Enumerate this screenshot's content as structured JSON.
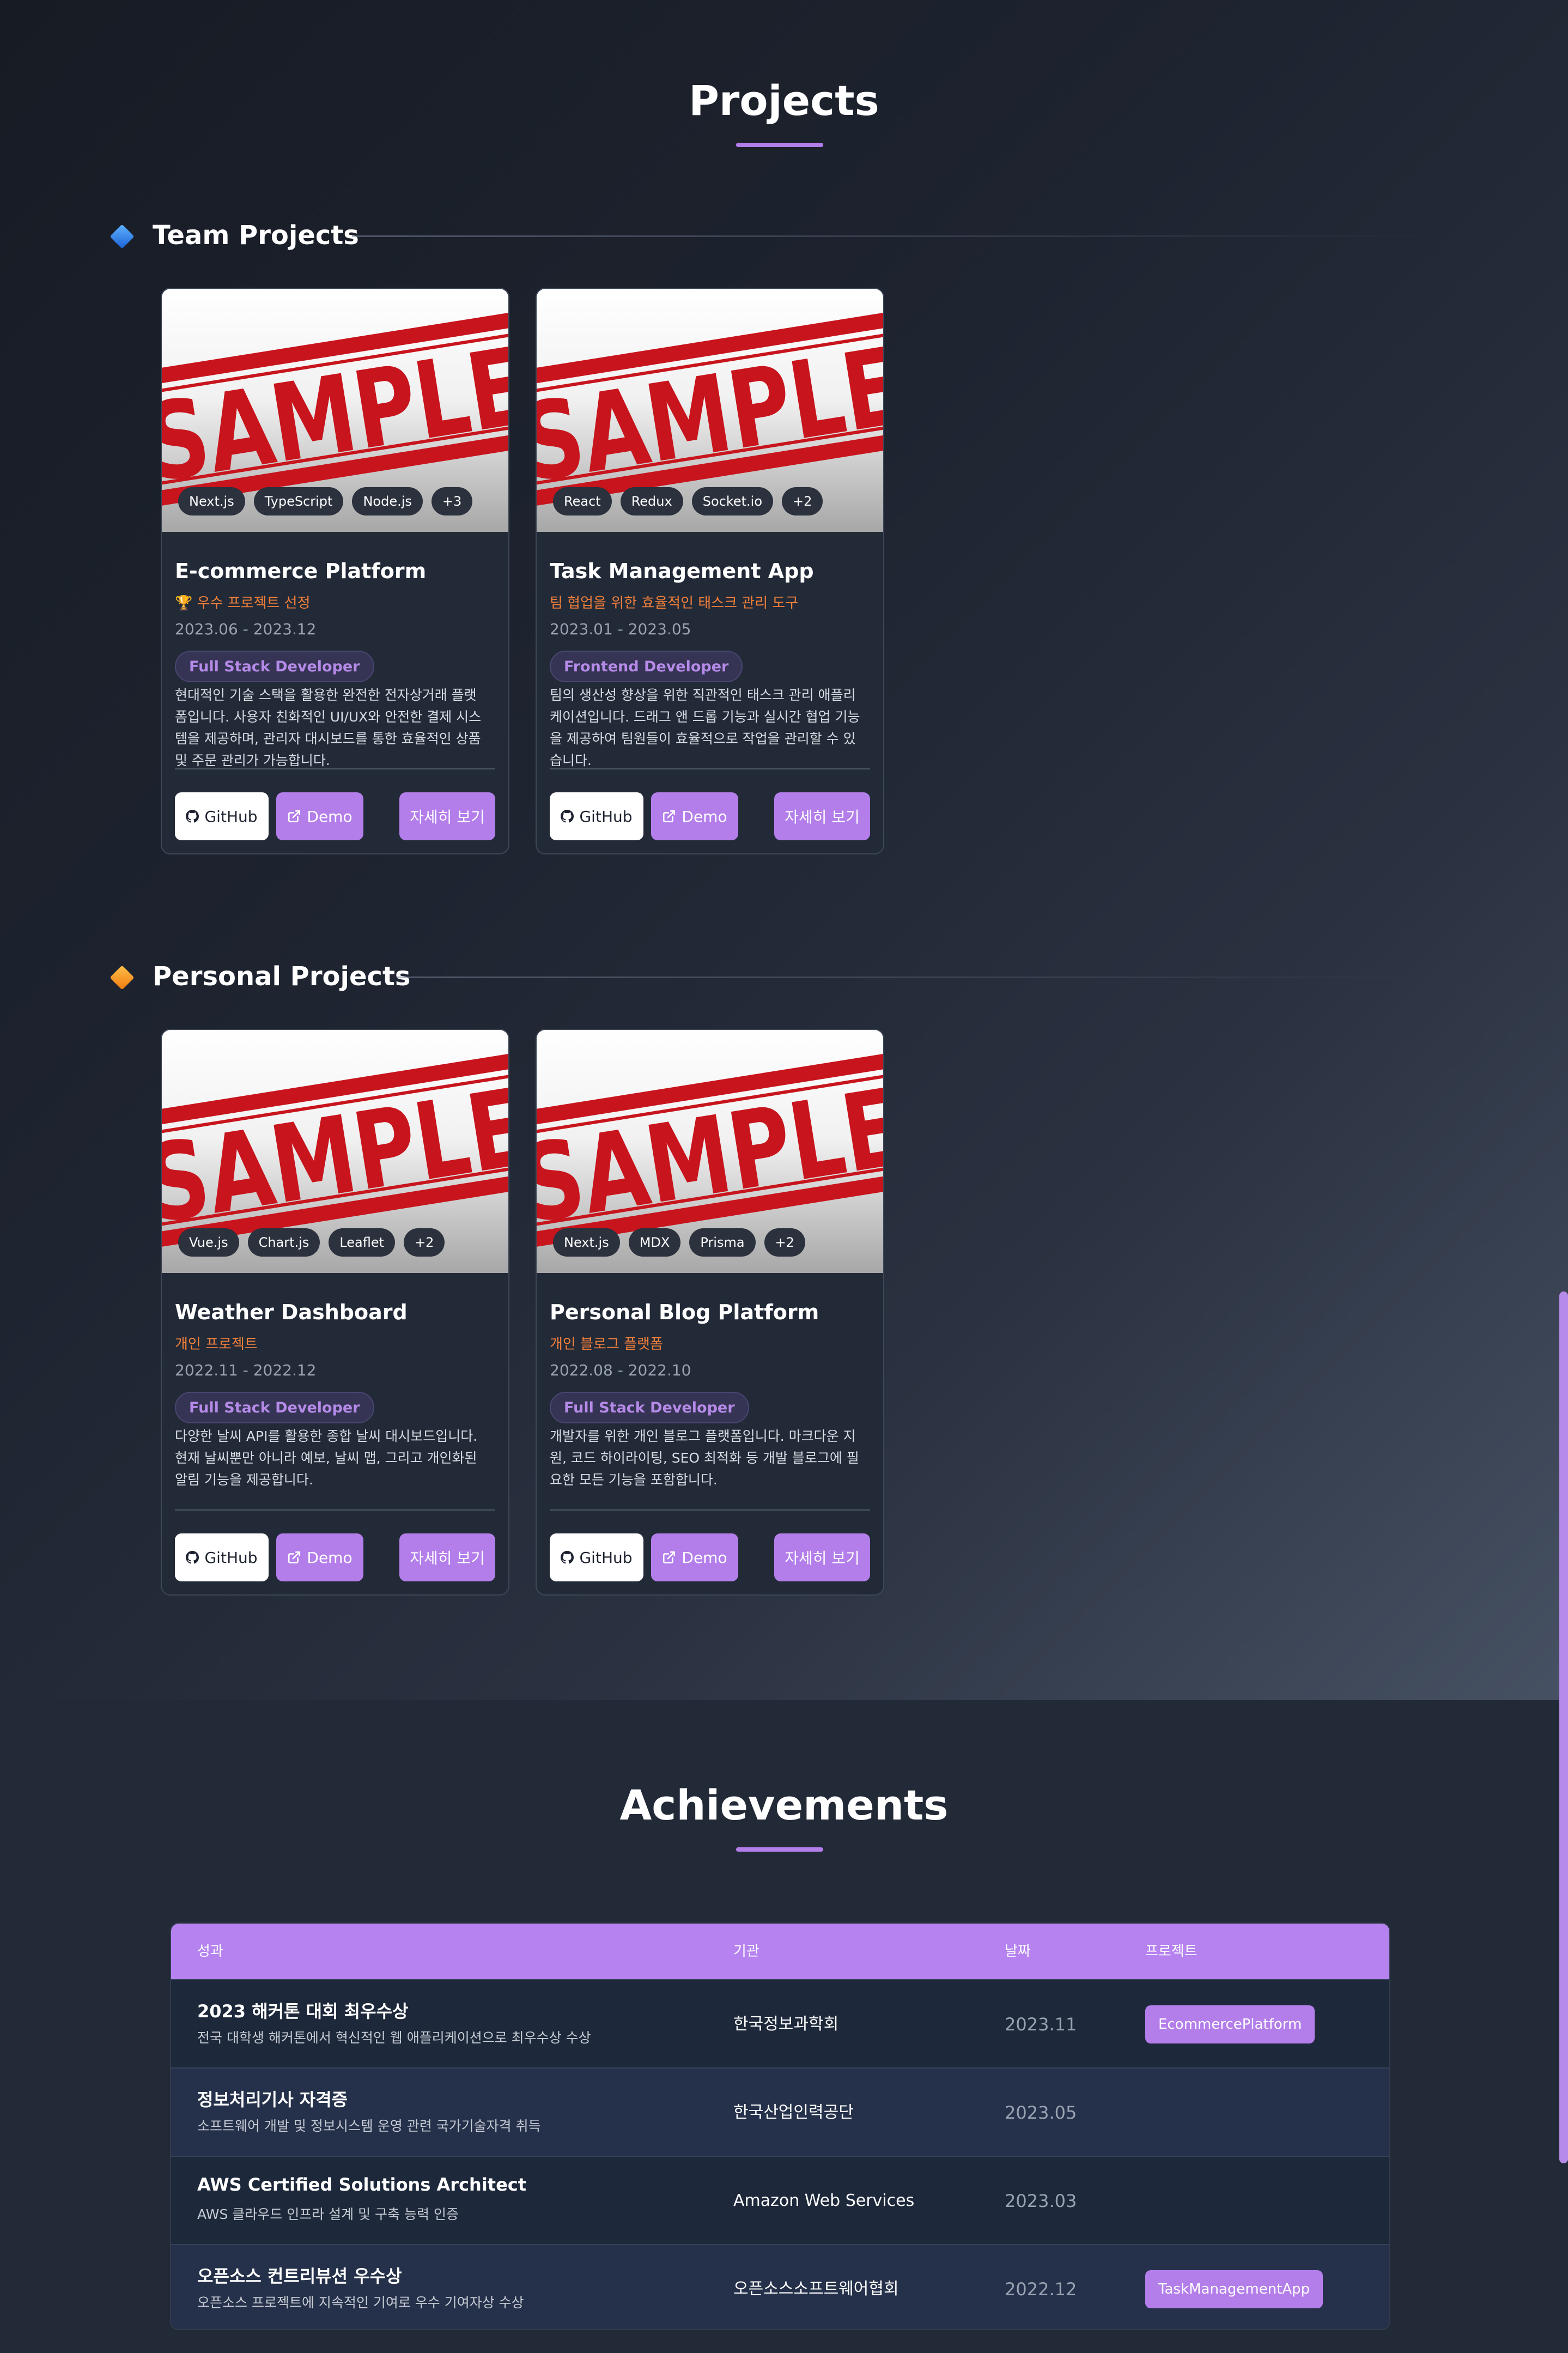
{
  "projects": {
    "title": "Projects",
    "team": {
      "title": "Team Projects",
      "cards": [
        {
          "image_text": "SAMPLE",
          "tags": [
            "Next.js",
            "TypeScript",
            "Node.js",
            "+3"
          ],
          "title": "E-commerce Platform",
          "subtitle": "🏆 우수 프로젝트 선정",
          "date": "2023.06 - 2023.12",
          "role": "Full Stack Developer",
          "description_lines": [
            "현대적인 기술 스택을 활용한 완전한 전자상거래 플랫",
            "폼입니다. 사용자 친화적인 UI/UX와 안전한 결제 시스",
            "템을 제공하며, 관리자 대시보드를 통한 효율적인 상품",
            "및 주문 관리가 가능합니다."
          ],
          "github_label": "GitHub",
          "demo_label": "Demo",
          "detail_label": "자세히 보기"
        },
        {
          "image_text": "SAMPLE",
          "tags": [
            "React",
            "Redux",
            "Socket.io",
            "+2"
          ],
          "title": "Task Management App",
          "subtitle": "팀 협업을 위한 효율적인 태스크 관리 도구",
          "date": "2023.01 - 2023.05",
          "role": "Frontend Developer",
          "description_lines": [
            "팀의 생산성 향상을 위한 직관적인 태스크 관리 애플리",
            "케이션입니다. 드래그 앤 드롭 기능과 실시간 협업 기능",
            "을 제공하여 팀원들이 효율적으로 작업을 관리할 수 있",
            "습니다."
          ],
          "github_label": "GitHub",
          "demo_label": "Demo",
          "detail_label": "자세히 보기"
        }
      ]
    },
    "personal": {
      "title": "Personal Projects",
      "cards": [
        {
          "image_text": "SAMPLE",
          "tags": [
            "Vue.js",
            "Chart.js",
            "Leaflet",
            "+2"
          ],
          "title": "Weather Dashboard",
          "subtitle": "개인 프로젝트",
          "date": "2022.11 - 2022.12",
          "role": "Full Stack Developer",
          "description_lines": [
            "다양한 날씨 API를 활용한 종합 날씨 대시보드입니다.",
            "현재 날씨뿐만 아니라 예보, 날씨 맵, 그리고 개인화된",
            "알림 기능을 제공합니다."
          ],
          "github_label": "GitHub",
          "demo_label": "Demo",
          "detail_label": "자세히 보기"
        },
        {
          "image_text": "SAMPLE",
          "tags": [
            "Next.js",
            "MDX",
            "Prisma",
            "+2"
          ],
          "title": "Personal Blog Platform",
          "subtitle": "개인 블로그 플랫폼",
          "date": "2022.08 - 2022.10",
          "role": "Full Stack Developer",
          "description_lines": [
            "개발자를 위한 개인 블로그 플랫폼입니다. 마크다운 지",
            "원, 코드 하이라이팅, SEO 최적화 등 개발 블로그에 필",
            "요한 모든 기능을 포함합니다."
          ],
          "github_label": "GitHub",
          "demo_label": "Demo",
          "detail_label": "자세히 보기"
        }
      ]
    }
  },
  "achievements": {
    "title": "Achievements",
    "headers": {
      "achievement": "성과",
      "organization": "기관",
      "date": "날짜",
      "project": "프로젝트"
    },
    "rows": [
      {
        "title": "2023 해커톤 대회 최우수상",
        "description": "전국 대학생 해커톤에서 혁신적인 웹 애플리케이션으로 최우수상 수상",
        "organization": "한국정보과학회",
        "date": "2023.11",
        "project": "EcommercePlatform"
      },
      {
        "title": "정보처리기사 자격증",
        "description": "소프트웨어 개발 및 정보시스템 운영 관련 국가기술자격 취득",
        "organization": "한국산업인력공단",
        "date": "2023.05",
        "project": ""
      },
      {
        "title": "AWS Certified Solutions Architect",
        "description": "AWS 클라우드 인프라 설계 및 구축 능력 인증",
        "organization": "Amazon Web Services",
        "date": "2023.03",
        "project": ""
      },
      {
        "title": "오픈소스 컨트리뷰션 우수상",
        "description": "오픈소스 프로젝트에 지속적인 기여로 우수 기여자상 수상",
        "organization": "오픈소스소프트웨어협회",
        "date": "2022.12",
        "project": "TaskManagementApp"
      }
    ]
  },
  "theme": {
    "accent": "#b47eea",
    "subtitle_color": "#f2803a",
    "team_marker": "blue-diamond-icon",
    "personal_marker": "orange-diamond-icon"
  }
}
